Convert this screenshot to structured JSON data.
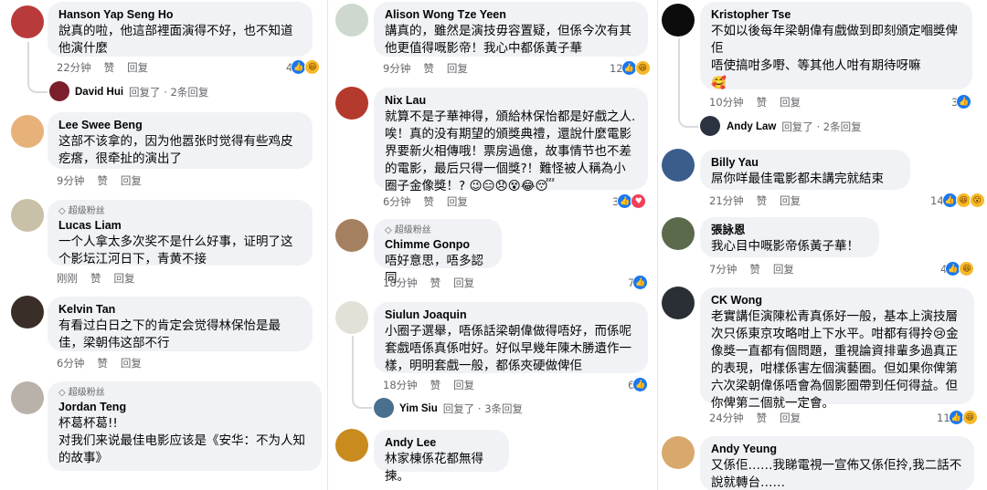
{
  "columns": [
    {
      "comments": [
        {
          "name": "Hanson Yap Seng Ho",
          "badge": "",
          "text": "說真的啦，他這部裡面演得不好，也不知道他演什麼",
          "time": "22分钟",
          "like": "赞",
          "reply": "回复",
          "reactions": "4",
          "reply_info": {
            "name": "David Hui",
            "text": "回复了 · 2条回复"
          }
        },
        {
          "name": "Lee Swee Beng",
          "badge": "",
          "text": "这部不该拿的，因为他嚣张时觉得有些鸡皮疙瘩，很牵扯的演出了",
          "time": "9分钟",
          "like": "赞",
          "reply": "回复",
          "reactions": ""
        },
        {
          "name": "Lucas Liam",
          "badge": "超级粉丝",
          "text": "一个人拿太多次奖不是什么好事，证明了这个影坛江河日下，青黄不接",
          "time": "刚刚",
          "like": "赞",
          "reply": "回复",
          "reactions": ""
        },
        {
          "name": "Kelvin Tan",
          "badge": "",
          "text": "有看过白日之下的肯定会觉得林保怡是最佳，梁朝伟这部不行",
          "time": "6分钟",
          "like": "赞",
          "reply": "回复",
          "reactions": ""
        },
        {
          "name": "Jordan Teng",
          "badge": "超级粉丝",
          "text": "杯葛杯葛!!\n对我们来说最佳电影应该是《安华：不为人知的故事》",
          "time": "",
          "like": "",
          "reply": "",
          "reactions": ""
        }
      ]
    },
    {
      "comments": [
        {
          "name": "Alison Wong Tze Yeen",
          "badge": "",
          "text": "講真的，雖然是演技毋容置疑，但係今次有其他更值得嘅影帝！我心中都係黃子華",
          "time": "9分钟",
          "like": "赞",
          "reply": "回复",
          "reactions": "12"
        },
        {
          "name": "Nix Lau",
          "badge": "",
          "text": "就算不是子華神得，頒給林保怡都是好戲之人.唉！真的没有期望的頒獎典禮，還說什麼電影界要新火相傳哦！票房過億，故事情节也不差的電影，最后只得一個獎?！難怪被人稱為小圈子金像獎！? 😉😑😞😵😂😴",
          "time": "6分钟",
          "like": "赞",
          "reply": "回复",
          "reactions": "3"
        },
        {
          "name": "Chimme Gonpo",
          "badge": "超级粉丝",
          "text": "唔好意思，唔多認同",
          "time": "18分钟",
          "like": "赞",
          "reply": "回复",
          "reactions": "7"
        },
        {
          "name": "Siulun Joaquin",
          "badge": "",
          "text": "小圈子選舉，唔係話梁朝偉做得唔好，而係呢套戲唔係真係咁好。好似早幾年陳木勝遺作一樣，明明套戲一般，都係夾硬做俾佢",
          "time": "18分钟",
          "like": "赞",
          "reply": "回复",
          "reactions": "6",
          "reply_info": {
            "name": "Yim Siu",
            "text": "回复了 · 3条回复"
          }
        },
        {
          "name": "Andy Lee",
          "badge": "",
          "text": "林家棟係花都無得揀。",
          "time": "",
          "like": "",
          "reply": "",
          "reactions": ""
        }
      ]
    },
    {
      "comments": [
        {
          "name": "Kristopher Tse",
          "badge": "",
          "text": "不如以後每年梁朝偉有戲做到即刻頒定嗰獎俾佢\n唔使搞咁多嘢、等其他人咁有期待呀嘛\n🥰",
          "time": "10分钟",
          "like": "赞",
          "reply": "回复",
          "reactions": "3",
          "reply_info": {
            "name": "Andy Law",
            "text": "回复了 · 2条回复"
          }
        },
        {
          "name": "Billy Yau",
          "badge": "",
          "text": "屌你咩最佳電影都未講完就結束",
          "time": "21分钟",
          "like": "赞",
          "reply": "回复",
          "reactions": "14"
        },
        {
          "name": "張詠恩",
          "badge": "",
          "text": "我心目中嘅影帝係黃子華！",
          "time": "7分钟",
          "like": "赞",
          "reply": "回复",
          "reactions": "4"
        },
        {
          "name": "CK Wong",
          "badge": "",
          "text": "老實講佢演陳松青真係好一般，基本上演技層次只係東京攻略咁上下水平。咁都有得拎😢金像獎一直都有個問題，重視論資排輩多過真正的表現，咁樣係害左個演藝圈。但如果你俾第六次梁朝偉係唔會為個影圈帶到任何得益。但你俾第二個就一定會。",
          "time": "24分钟",
          "like": "赞",
          "reply": "回复",
          "reactions": "11"
        },
        {
          "name": "Andy Yeung",
          "badge": "",
          "text": "又係佢……我睇電視一宣佈又係佢拎,我二話不說就轉台……",
          "time": "",
          "like": "",
          "reply": "",
          "reactions": ""
        }
      ]
    }
  ]
}
